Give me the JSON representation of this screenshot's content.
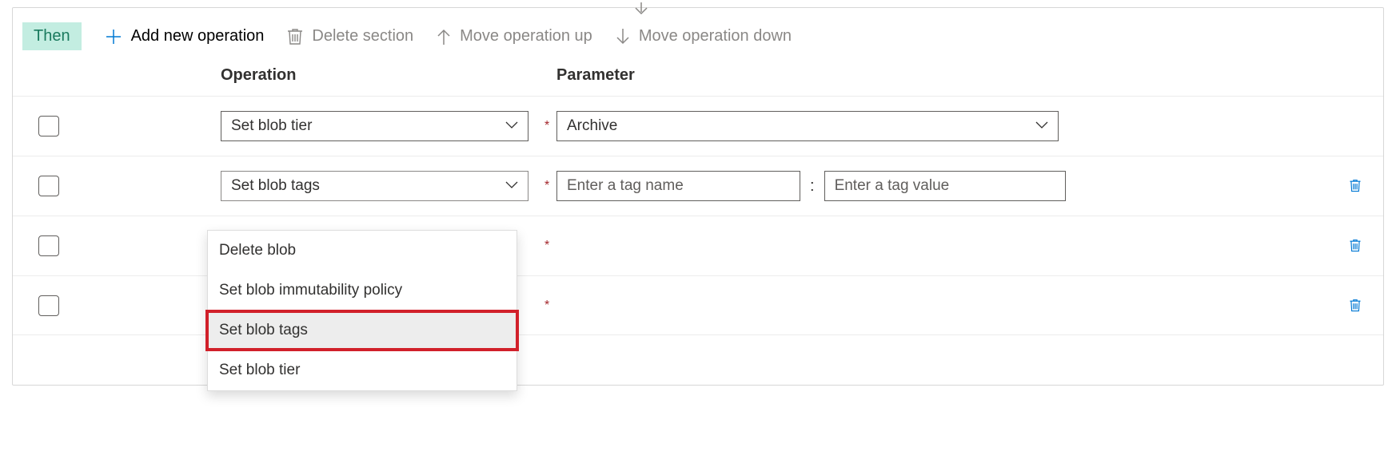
{
  "badge": {
    "label": "Then"
  },
  "toolbar": {
    "add": {
      "label": "Add new operation"
    },
    "delete": {
      "label": "Delete section"
    },
    "up": {
      "label": "Move operation up"
    },
    "down": {
      "label": "Move operation down"
    }
  },
  "columns": {
    "operation": "Operation",
    "parameter": "Parameter"
  },
  "required_mark": "*",
  "colon": ":",
  "rows": {
    "r0": {
      "operation_selected": "Set blob tier",
      "parameter_selected": "Archive"
    },
    "r1": {
      "operation_selected": "Set blob tags",
      "tag_name_placeholder": "Enter a tag name",
      "tag_value_placeholder": "Enter a tag value"
    },
    "r2": {},
    "r3": {}
  },
  "dropdown": {
    "options": {
      "o0": "Delete blob",
      "o1": "Set blob immutability policy",
      "o2": "Set blob tags",
      "o3": "Set blob tier"
    },
    "highlighted": "o2"
  },
  "colors": {
    "accent_blue": "#0078d4",
    "teal_bg": "#c3ede1",
    "teal_text": "#1a7a5e",
    "highlight_red": "#d1202a"
  }
}
